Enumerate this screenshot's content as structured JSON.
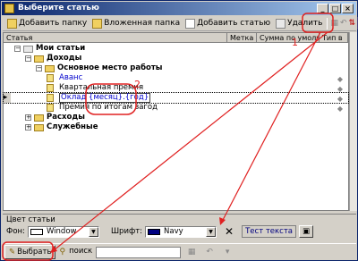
{
  "window": {
    "title": "Выберите статью",
    "minimize": "_",
    "maximize": "□",
    "close": "×"
  },
  "toolbar": {
    "add_folder": "Добавить папку",
    "nested_folder": "Вложенная папка",
    "add_item": "Добавить статью",
    "delete": "Удалить"
  },
  "grid": {
    "columns": [
      "Статья",
      "Метка",
      "Сумма по умолч",
      "Тип в"
    ],
    "rows": [
      {
        "level": 0,
        "kind": "root",
        "label": "Мои статьи",
        "bold": true,
        "exp": "−"
      },
      {
        "level": 1,
        "kind": "folder",
        "label": "Доходы",
        "bold": true,
        "exp": "−"
      },
      {
        "level": 2,
        "kind": "folder",
        "label": "Основное место работы",
        "bold": true,
        "exp": "−"
      },
      {
        "level": 3,
        "kind": "item",
        "label": "Аванс",
        "color": "#0000cc",
        "arrow": true
      },
      {
        "level": 3,
        "kind": "item",
        "label": "Квартальная премия",
        "arrow": true
      },
      {
        "level": 3,
        "kind": "item",
        "label": "Оклад {месяц}.{год}",
        "color": "#0000cc",
        "arrow": true,
        "selected": true
      },
      {
        "level": 3,
        "kind": "item",
        "label": "Премия по итогам загод",
        "arrow": true
      },
      {
        "level": 1,
        "kind": "folder",
        "label": "Расходы",
        "bold": true,
        "exp": "+"
      },
      {
        "level": 1,
        "kind": "folder",
        "label": "Служебные",
        "bold": true,
        "exp": "+"
      }
    ]
  },
  "color_panel": {
    "title": "Цвет статьи",
    "bg_label": "Фон:",
    "bg_value": "Window",
    "font_label": "Шрифт:",
    "font_value": "Navy",
    "font_color": "#000080",
    "clear": "✕",
    "test_text": "Тест текста"
  },
  "bottom": {
    "select": "Выбрать",
    "search_label": "поиск",
    "search_value": ""
  },
  "annotations": {
    "label1": "1",
    "label2": "2",
    "color": "#e02020"
  }
}
